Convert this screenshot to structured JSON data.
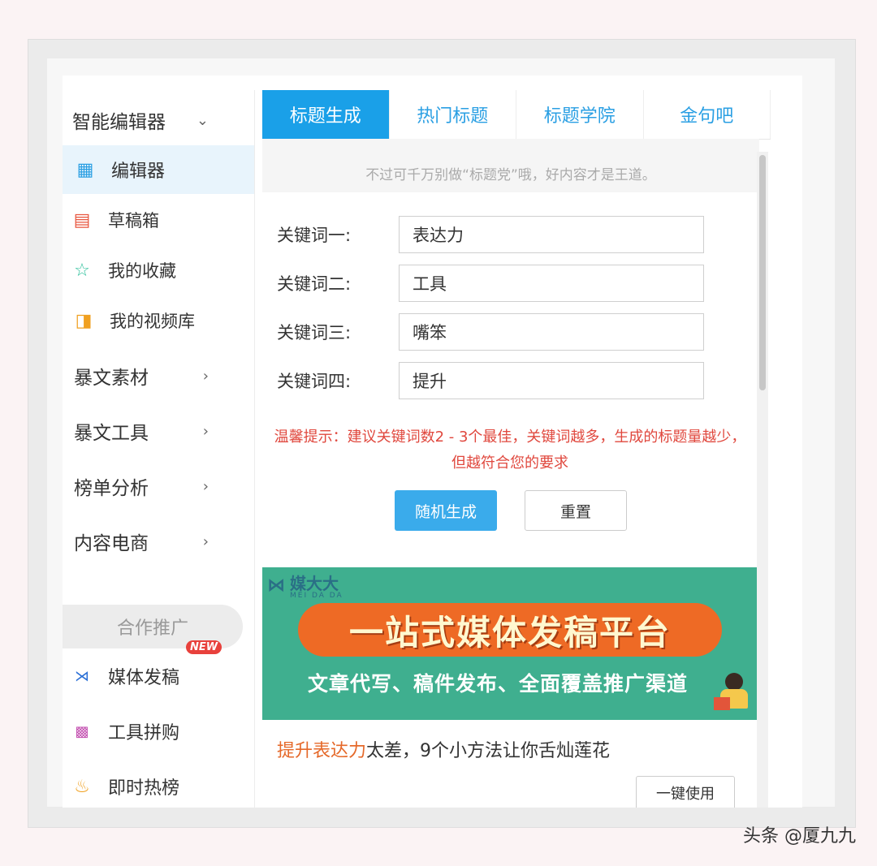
{
  "sidebar": {
    "header": {
      "label": "智能编辑器",
      "chevron": "chevron-down"
    },
    "items": [
      {
        "icon": "grid-icon",
        "label": "编辑器",
        "active": true
      },
      {
        "icon": "draft-icon",
        "label": "草稿箱"
      },
      {
        "icon": "star-icon",
        "label": "我的收藏"
      },
      {
        "icon": "video-icon",
        "label": "我的视频库"
      }
    ],
    "groups": [
      {
        "label": "暴文素材"
      },
      {
        "label": "暴文工具"
      },
      {
        "label": "榜单分析"
      },
      {
        "label": "内容电商"
      }
    ],
    "partner_label": "合作推广",
    "partner_items": [
      {
        "icon": "media-icon",
        "label": "媒体发稿",
        "badge": "NEW"
      },
      {
        "icon": "tool-icon",
        "label": "工具拼购"
      },
      {
        "icon": "fire-icon",
        "label": "即时热榜"
      }
    ]
  },
  "tabs": [
    {
      "label": "标题生成",
      "active": true
    },
    {
      "label": "热门标题"
    },
    {
      "label": "标题学院"
    },
    {
      "label": "金句吧"
    }
  ],
  "tip": {
    "line2": "不过可千万别做“标题党”哦，好内容才是王道。"
  },
  "keywords": [
    {
      "label": "关键词一:",
      "value": "表达力"
    },
    {
      "label": "关键词二:",
      "value": "工具"
    },
    {
      "label": "关键词三:",
      "value": "嘴笨"
    },
    {
      "label": "关键词四:",
      "value": "提升"
    }
  ],
  "warning": "温馨提示：建议关键词数2 - 3个最佳，关键词越多，生成的标题量越少，但越符合您的要求",
  "buttons": {
    "generate": "随机生成",
    "reset": "重置"
  },
  "banner": {
    "brand": "媒大大",
    "brand_sub": "MEI DA DA",
    "title": "一站式媒体发稿平台",
    "subtitle": "文章代写、稿件发布、全面覆盖推广渠道",
    "colors": {
      "bg": "#3faf8f",
      "pill": "#ee6a25"
    }
  },
  "result": {
    "highlight": "提升表达力",
    "rest": "太差，9个小方法让你舌灿莲花",
    "use_button": "一键使用"
  },
  "watermark": "头条 @厦九九",
  "colors": {
    "accent": "#1aa0e8",
    "warning": "#e0483e"
  }
}
